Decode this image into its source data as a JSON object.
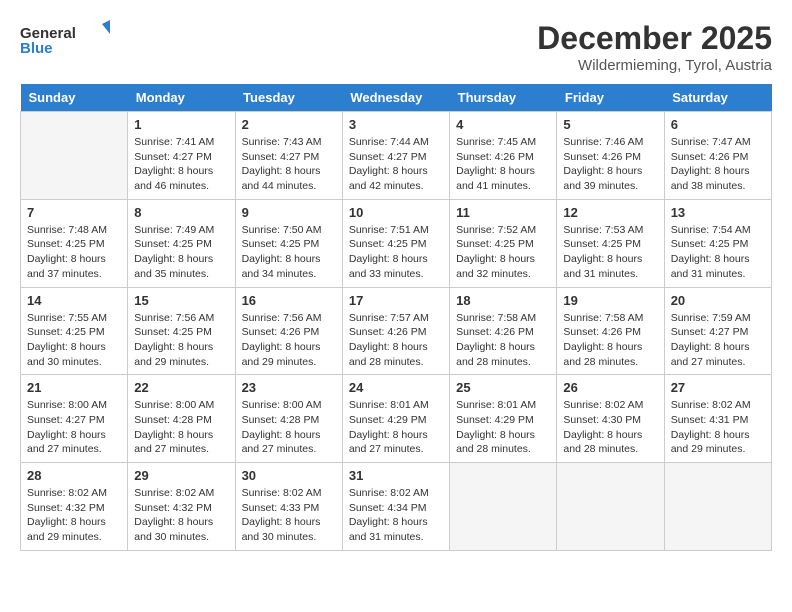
{
  "header": {
    "logo_line1": "General",
    "logo_line2": "Blue",
    "month": "December 2025",
    "location": "Wildermieming, Tyrol, Austria"
  },
  "weekdays": [
    "Sunday",
    "Monday",
    "Tuesday",
    "Wednesday",
    "Thursday",
    "Friday",
    "Saturday"
  ],
  "weeks": [
    [
      {
        "day": "",
        "info": ""
      },
      {
        "day": "1",
        "info": "Sunrise: 7:41 AM\nSunset: 4:27 PM\nDaylight: 8 hours\nand 46 minutes."
      },
      {
        "day": "2",
        "info": "Sunrise: 7:43 AM\nSunset: 4:27 PM\nDaylight: 8 hours\nand 44 minutes."
      },
      {
        "day": "3",
        "info": "Sunrise: 7:44 AM\nSunset: 4:27 PM\nDaylight: 8 hours\nand 42 minutes."
      },
      {
        "day": "4",
        "info": "Sunrise: 7:45 AM\nSunset: 4:26 PM\nDaylight: 8 hours\nand 41 minutes."
      },
      {
        "day": "5",
        "info": "Sunrise: 7:46 AM\nSunset: 4:26 PM\nDaylight: 8 hours\nand 39 minutes."
      },
      {
        "day": "6",
        "info": "Sunrise: 7:47 AM\nSunset: 4:26 PM\nDaylight: 8 hours\nand 38 minutes."
      }
    ],
    [
      {
        "day": "7",
        "info": "Sunrise: 7:48 AM\nSunset: 4:25 PM\nDaylight: 8 hours\nand 37 minutes."
      },
      {
        "day": "8",
        "info": "Sunrise: 7:49 AM\nSunset: 4:25 PM\nDaylight: 8 hours\nand 35 minutes."
      },
      {
        "day": "9",
        "info": "Sunrise: 7:50 AM\nSunset: 4:25 PM\nDaylight: 8 hours\nand 34 minutes."
      },
      {
        "day": "10",
        "info": "Sunrise: 7:51 AM\nSunset: 4:25 PM\nDaylight: 8 hours\nand 33 minutes."
      },
      {
        "day": "11",
        "info": "Sunrise: 7:52 AM\nSunset: 4:25 PM\nDaylight: 8 hours\nand 32 minutes."
      },
      {
        "day": "12",
        "info": "Sunrise: 7:53 AM\nSunset: 4:25 PM\nDaylight: 8 hours\nand 31 minutes."
      },
      {
        "day": "13",
        "info": "Sunrise: 7:54 AM\nSunset: 4:25 PM\nDaylight: 8 hours\nand 31 minutes."
      }
    ],
    [
      {
        "day": "14",
        "info": "Sunrise: 7:55 AM\nSunset: 4:25 PM\nDaylight: 8 hours\nand 30 minutes."
      },
      {
        "day": "15",
        "info": "Sunrise: 7:56 AM\nSunset: 4:25 PM\nDaylight: 8 hours\nand 29 minutes."
      },
      {
        "day": "16",
        "info": "Sunrise: 7:56 AM\nSunset: 4:26 PM\nDaylight: 8 hours\nand 29 minutes."
      },
      {
        "day": "17",
        "info": "Sunrise: 7:57 AM\nSunset: 4:26 PM\nDaylight: 8 hours\nand 28 minutes."
      },
      {
        "day": "18",
        "info": "Sunrise: 7:58 AM\nSunset: 4:26 PM\nDaylight: 8 hours\nand 28 minutes."
      },
      {
        "day": "19",
        "info": "Sunrise: 7:58 AM\nSunset: 4:26 PM\nDaylight: 8 hours\nand 28 minutes."
      },
      {
        "day": "20",
        "info": "Sunrise: 7:59 AM\nSunset: 4:27 PM\nDaylight: 8 hours\nand 27 minutes."
      }
    ],
    [
      {
        "day": "21",
        "info": "Sunrise: 8:00 AM\nSunset: 4:27 PM\nDaylight: 8 hours\nand 27 minutes."
      },
      {
        "day": "22",
        "info": "Sunrise: 8:00 AM\nSunset: 4:28 PM\nDaylight: 8 hours\nand 27 minutes."
      },
      {
        "day": "23",
        "info": "Sunrise: 8:00 AM\nSunset: 4:28 PM\nDaylight: 8 hours\nand 27 minutes."
      },
      {
        "day": "24",
        "info": "Sunrise: 8:01 AM\nSunset: 4:29 PM\nDaylight: 8 hours\nand 27 minutes."
      },
      {
        "day": "25",
        "info": "Sunrise: 8:01 AM\nSunset: 4:29 PM\nDaylight: 8 hours\nand 28 minutes."
      },
      {
        "day": "26",
        "info": "Sunrise: 8:02 AM\nSunset: 4:30 PM\nDaylight: 8 hours\nand 28 minutes."
      },
      {
        "day": "27",
        "info": "Sunrise: 8:02 AM\nSunset: 4:31 PM\nDaylight: 8 hours\nand 29 minutes."
      }
    ],
    [
      {
        "day": "28",
        "info": "Sunrise: 8:02 AM\nSunset: 4:32 PM\nDaylight: 8 hours\nand 29 minutes."
      },
      {
        "day": "29",
        "info": "Sunrise: 8:02 AM\nSunset: 4:32 PM\nDaylight: 8 hours\nand 30 minutes."
      },
      {
        "day": "30",
        "info": "Sunrise: 8:02 AM\nSunset: 4:33 PM\nDaylight: 8 hours\nand 30 minutes."
      },
      {
        "day": "31",
        "info": "Sunrise: 8:02 AM\nSunset: 4:34 PM\nDaylight: 8 hours\nand 31 minutes."
      },
      {
        "day": "",
        "info": ""
      },
      {
        "day": "",
        "info": ""
      },
      {
        "day": "",
        "info": ""
      }
    ]
  ]
}
